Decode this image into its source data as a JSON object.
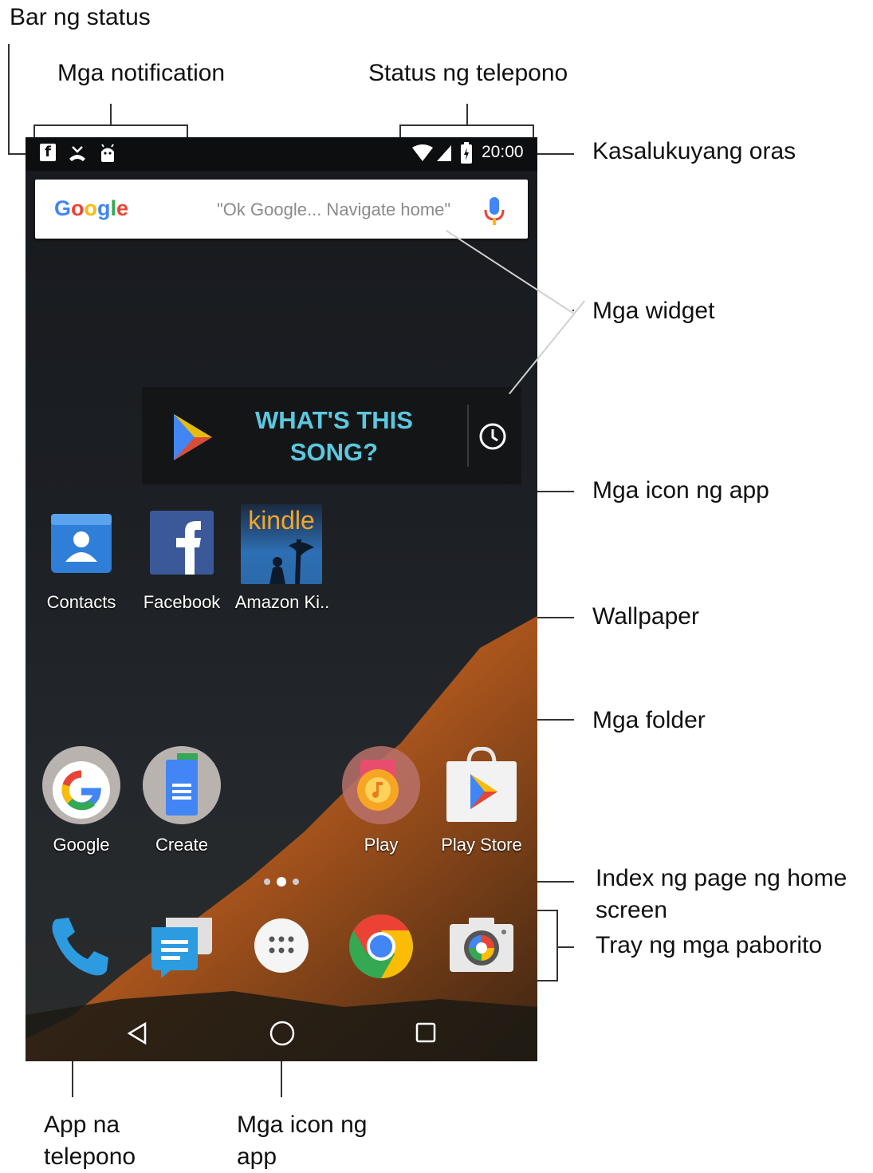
{
  "callouts": {
    "status_bar": "Bar ng status",
    "notifications": "Mga notification",
    "phone_status": "Status ng telepono",
    "current_time": "Kasalukuyang oras",
    "widgets": "Mga widget",
    "app_icons": "Mga icon ng app",
    "wallpaper": "Wallpaper",
    "folders": "Mga folder",
    "page_index_line1": "Index ng page ng home",
    "page_index_line2": "screen",
    "favorites_tray": "Tray ng mga paborito",
    "phone_app_line1": "App na",
    "phone_app_line2": "telepono",
    "app_icons_bottom_line1": "Mga icon ng",
    "app_icons_bottom_line2": "app"
  },
  "status_bar": {
    "time": "20:00",
    "notification_icons": [
      "facebook-icon",
      "missed-call-icon",
      "android-icon"
    ],
    "status_icons": [
      "wifi-icon",
      "signal-icon",
      "battery-charging-icon"
    ]
  },
  "search_widget": {
    "logo": "Google",
    "hint": "\"Ok Google... Navigate home\"",
    "mic_icon": "mic-icon"
  },
  "song_widget": {
    "line1": "WHAT'S THIS",
    "line2": "SONG?",
    "play_icon": "play-triangle-icon",
    "history_icon": "clock-icon"
  },
  "apps_row1": [
    {
      "label": "Contacts",
      "icon": "contacts-icon"
    },
    {
      "label": "Facebook",
      "icon": "facebook-icon"
    },
    {
      "label": "Amazon Ki..",
      "icon": "kindle-icon",
      "icon_text": "kindle"
    }
  ],
  "apps_row2": [
    {
      "label": "Google",
      "icon": "google-folder-icon"
    },
    {
      "label": "Create",
      "icon": "create-folder-icon"
    },
    {
      "label": "Play",
      "icon": "play-folder-icon"
    },
    {
      "label": "Play Store",
      "icon": "play-store-icon"
    }
  ],
  "dock": [
    "phone-icon",
    "messages-icon",
    "app-drawer-icon",
    "chrome-icon",
    "camera-icon"
  ],
  "colors": {
    "widget_text": "#5cc8e0",
    "wallpaper_hill": "#c8671c",
    "google_blue": "#4285f4",
    "google_red": "#ea4335",
    "google_yellow": "#fbbc05",
    "google_green": "#34a853",
    "facebook_blue": "#3b5998"
  }
}
